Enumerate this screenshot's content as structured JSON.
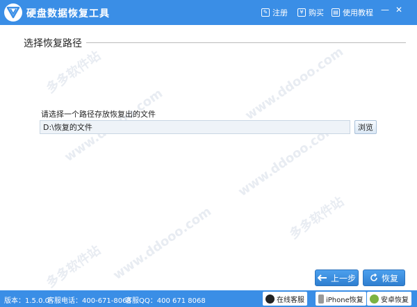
{
  "titlebar": {
    "title": "硬盘数据恢复工具",
    "register": "注册",
    "buy": "购买",
    "tutorial": "使用教程",
    "minimize": "—",
    "close": "✕"
  },
  "main": {
    "section_title": "选择恢复路径",
    "prompt": "请选择一个路径存放恢复出的文件",
    "path_value": "D:\\恢复的文件",
    "browse_label": "浏览"
  },
  "actions": {
    "prev_label": "上一步",
    "recover_label": "恢复"
  },
  "statusbar": {
    "version": "版本：1.5.0.0",
    "phone": "客服电话：400-671-8068",
    "qq": "客服QQ：400 671 8068",
    "online_service": "在线客服",
    "iphone_recover": "iPhone恢复",
    "android_recover": "安卓恢复"
  },
  "watermark": {
    "site": "www.ddooo.com",
    "brand": "多多软件站"
  },
  "colors": {
    "accent": "#3a8ee6",
    "button": "#2f7fd0"
  }
}
